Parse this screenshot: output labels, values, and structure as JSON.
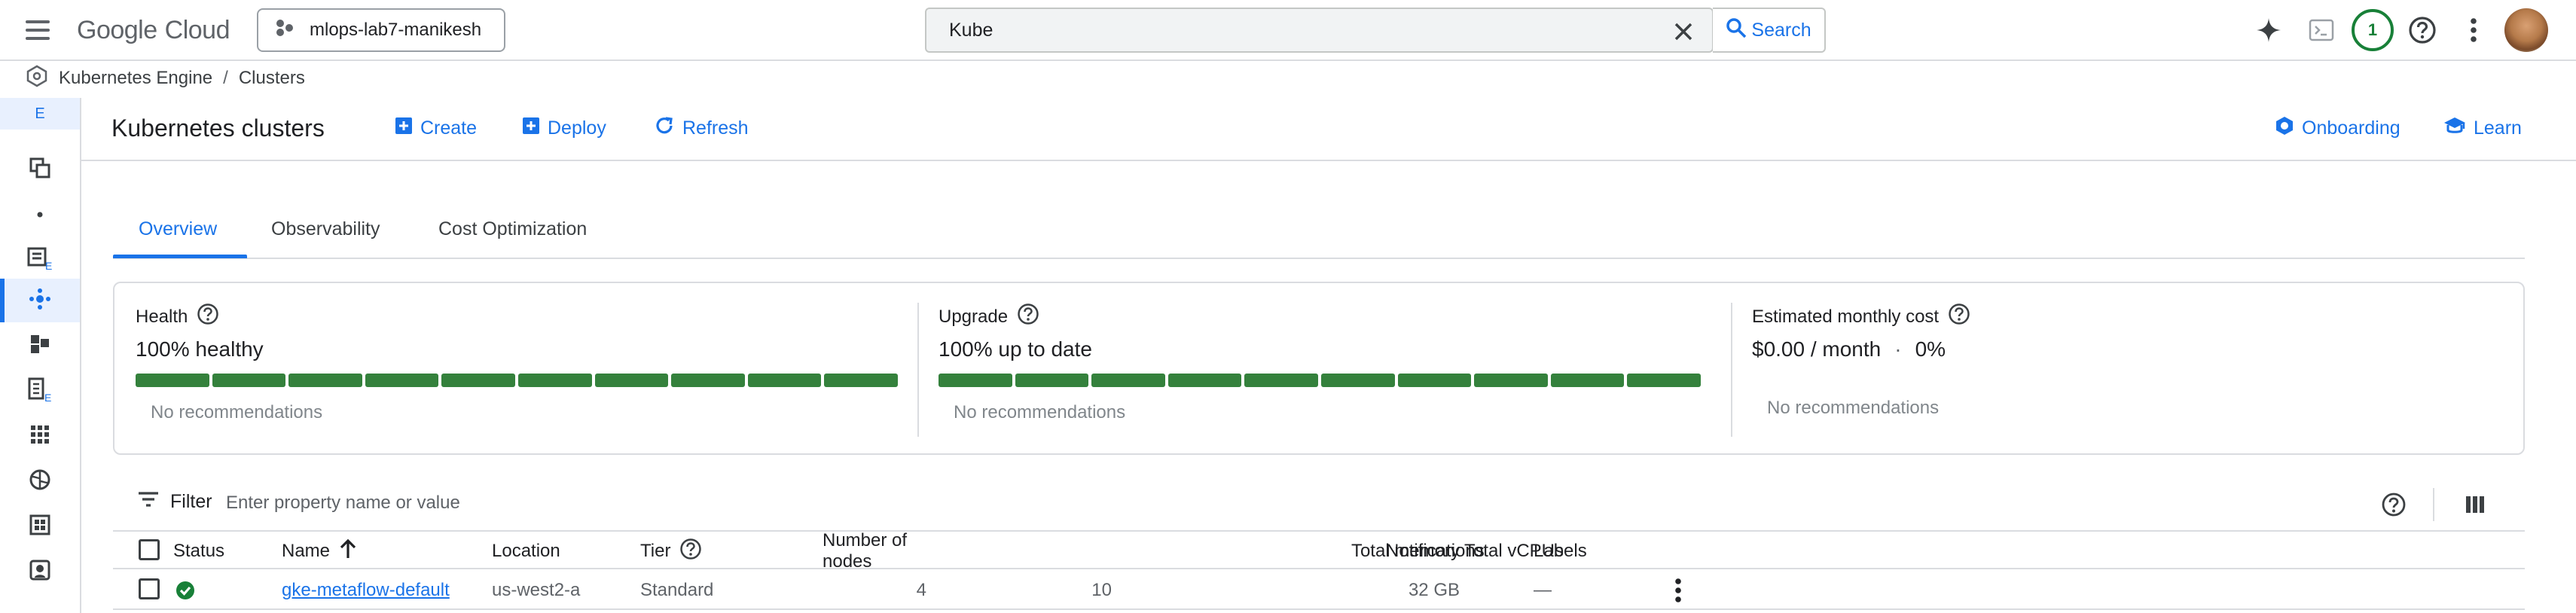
{
  "topbar": {
    "logo_google": "Google",
    "logo_cloud": "Cloud",
    "project": "mlops-lab7-manikesh",
    "search_value": "Kube",
    "search_button": "Search",
    "notification_count": "1"
  },
  "breadcrumb": {
    "items": [
      "Kubernetes Engine",
      "Clusters"
    ],
    "separator": "/"
  },
  "sidebar": {
    "top_label": "E",
    "active_index": 4
  },
  "page": {
    "title": "Kubernetes clusters",
    "actions": {
      "create": "Create",
      "deploy": "Deploy",
      "refresh": "Refresh",
      "onboarding": "Onboarding",
      "learn": "Learn"
    }
  },
  "tabs": [
    {
      "label": "Overview",
      "active": true
    },
    {
      "label": "Observability",
      "active": false
    },
    {
      "label": "Cost Optimization",
      "active": false
    }
  ],
  "summary": {
    "health": {
      "label": "Health",
      "value": "100% healthy",
      "note": "No recommendations",
      "progress": 1.0,
      "segments": 10
    },
    "upgrade": {
      "label": "Upgrade",
      "value": "100% up to date",
      "note": "No recommendations",
      "progress": 1.0,
      "segments": 10
    },
    "cost": {
      "label": "Estimated monthly cost",
      "value": "$0.00 / month",
      "dot": "·",
      "percent": "0%",
      "note": "No recommendations"
    }
  },
  "filter": {
    "label": "Filter",
    "placeholder": "Enter property name or value"
  },
  "table": {
    "headers": {
      "status": "Status",
      "name": "Name",
      "location": "Location",
      "tier": "Tier",
      "nodes": "Number of nodes",
      "vcpus": "Total vCPUs",
      "memory": "Total memory",
      "notifications": "Notifications",
      "labels": "Labels"
    },
    "sort": {
      "column": "name",
      "direction": "ascending"
    },
    "rows": [
      {
        "status": "healthy",
        "name": "gke-metaflow-default",
        "location": "us-west2-a",
        "tier": "Standard",
        "nodes": "4",
        "vcpus": "10",
        "memory": "32 GB",
        "notifications": "",
        "labels": "—"
      }
    ]
  },
  "colors": {
    "accent": "#1a73e8",
    "healthy": "#188038",
    "bar": "#34813c",
    "border": "#dadce0"
  }
}
